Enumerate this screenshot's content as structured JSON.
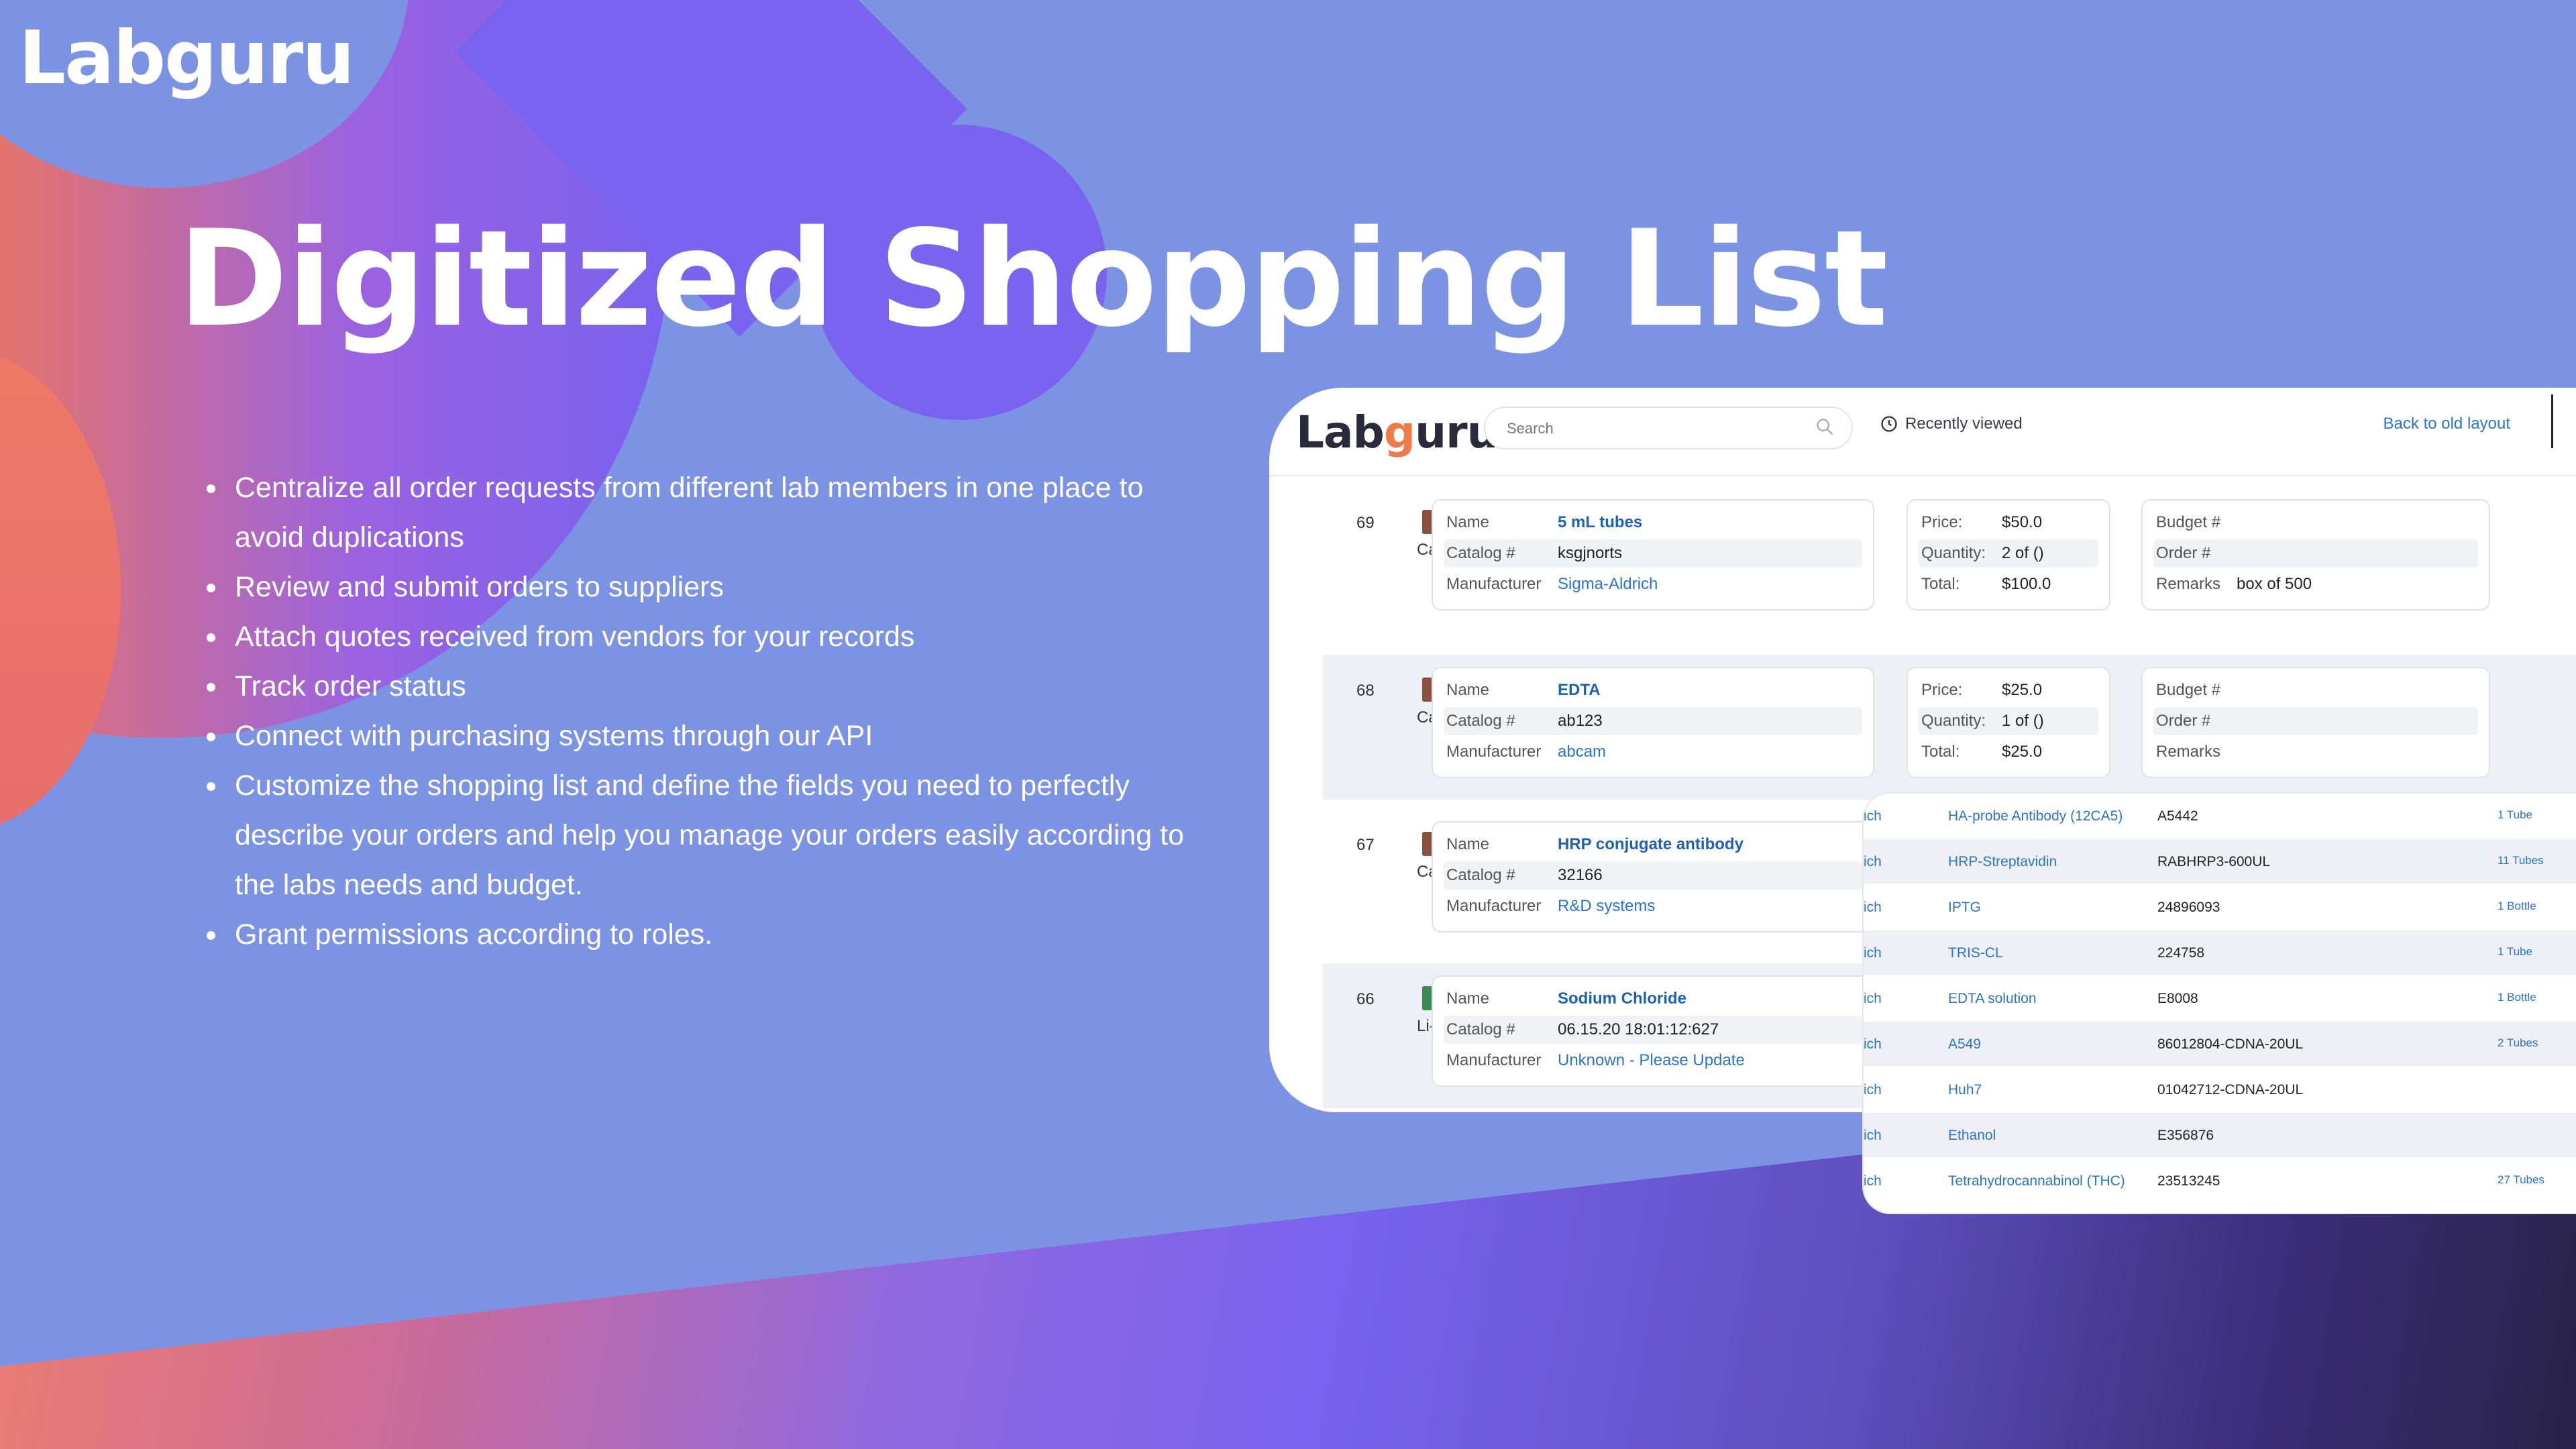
{
  "brand": {
    "logo": "Labguru"
  },
  "hero": {
    "title": "Digitized Shopping List",
    "bullets": [
      "Centralize all order requests from different lab members in one place to avoid duplications",
      "Review and submit orders to suppliers",
      "Attach quotes received from vendors for your records",
      "Track order status",
      "Connect with purchasing systems through our API",
      "Customize the shopping list and define the fields you need to perfectly describe your orders and help you manage your orders easily according to the labs needs and budget.",
      "Grant permissions  according to roles."
    ]
  },
  "app": {
    "logo_a": "Lab",
    "logo_g": "g",
    "logo_b": "uru",
    "search_placeholder": "Search",
    "recently_viewed": "Recently viewed",
    "back_link": "Back to old layout",
    "labels": {
      "name": "Name",
      "catalog": "Catalog #",
      "manufacturer": "Manufacturer",
      "price": "Price:",
      "quantity": "Quantity:",
      "total": "Total:",
      "budget": "Budget #",
      "order": "Order #",
      "remarks": "Remarks"
    },
    "orders": [
      {
        "id": "69",
        "user": "Carl",
        "name": "5 mL tubes",
        "catalog": "ksgjnorts",
        "manufacturer": "Sigma-Aldrich",
        "price": "$50.0",
        "quantity": "2 of ()",
        "total": "$100.0",
        "remarks": "box of 500"
      },
      {
        "id": "68",
        "user": "Carl",
        "name": "EDTA",
        "catalog": "ab123",
        "manufacturer": "abcam",
        "price": "$25.0",
        "quantity": "1 of ()",
        "total": "$25.0",
        "remarks": ""
      },
      {
        "id": "67",
        "user": "Carl",
        "name": "HRP conjugate antibody",
        "catalog": "32166",
        "manufacturer": "R&D systems"
      },
      {
        "id": "66",
        "user": "Li-or",
        "name": "Sodium Chloride",
        "catalog": "06.15.20 18:01:12:627",
        "manufacturer": "Unknown - Please Update"
      }
    ]
  },
  "overlay": {
    "rows": [
      {
        "vendor": "ich",
        "item": "HA-probe Antibody (12CA5)",
        "catalog": "A5442",
        "qty": "1 Tube"
      },
      {
        "vendor": "ich",
        "item": "HRP-Streptavidin",
        "catalog": "RABHRP3-600UL",
        "qty": "11 Tubes"
      },
      {
        "vendor": "ich",
        "item": "IPTG",
        "catalog": "24896093",
        "qty": "1 Bottle"
      },
      {
        "vendor": "ich",
        "item": "TRIS-CL",
        "catalog": "224758",
        "qty": "1 Tube"
      },
      {
        "vendor": "ich",
        "item": "EDTA solution",
        "catalog": "E8008",
        "qty": "1 Bottle"
      },
      {
        "vendor": "ich",
        "item": "A549",
        "catalog": "86012804-CDNA-20UL",
        "qty": "2 Tubes"
      },
      {
        "vendor": "ich",
        "item": "Huh7",
        "catalog": "01042712-CDNA-20UL",
        "qty": ""
      },
      {
        "vendor": "ich",
        "item": "Ethanol",
        "catalog": "E356876",
        "qty": ""
      },
      {
        "vendor": "ich",
        "item": "Tetrahydrocannabinol (THC)",
        "catalog": "23513245",
        "qty": "27 Tubes"
      }
    ]
  }
}
